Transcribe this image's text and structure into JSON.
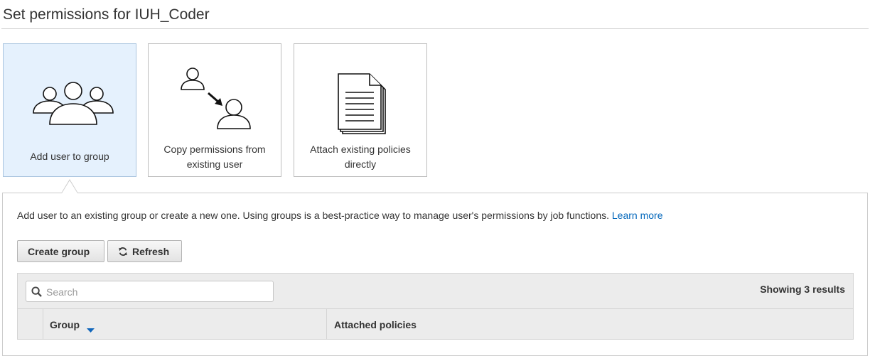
{
  "page": {
    "title": "Set permissions for IUH_Coder"
  },
  "options": [
    {
      "label": "Add user to group",
      "icon": "users-group-icon",
      "selected": true
    },
    {
      "label": "Copy permissions from existing user",
      "icon": "copy-user-icon",
      "selected": false
    },
    {
      "label": "Attach existing policies directly",
      "icon": "documents-icon",
      "selected": false
    }
  ],
  "panel": {
    "description": "Add user to an existing group or create a new one. Using groups is a best-practice way to manage user's permissions by job functions.",
    "learn_more": "Learn more"
  },
  "toolbar": {
    "create_group_label": "Create group",
    "refresh_label": "Refresh",
    "refresh_icon": "refresh-icon"
  },
  "table": {
    "search_placeholder": "Search",
    "search_value": "",
    "results_text": "Showing 3 results",
    "columns": [
      {
        "label": "Group",
        "sort": "descending"
      },
      {
        "label": "Attached policies"
      }
    ]
  },
  "colors": {
    "selected_card_bg": "#e5f1fd",
    "link": "#0066bb",
    "sort_icon": "#1166bb"
  }
}
